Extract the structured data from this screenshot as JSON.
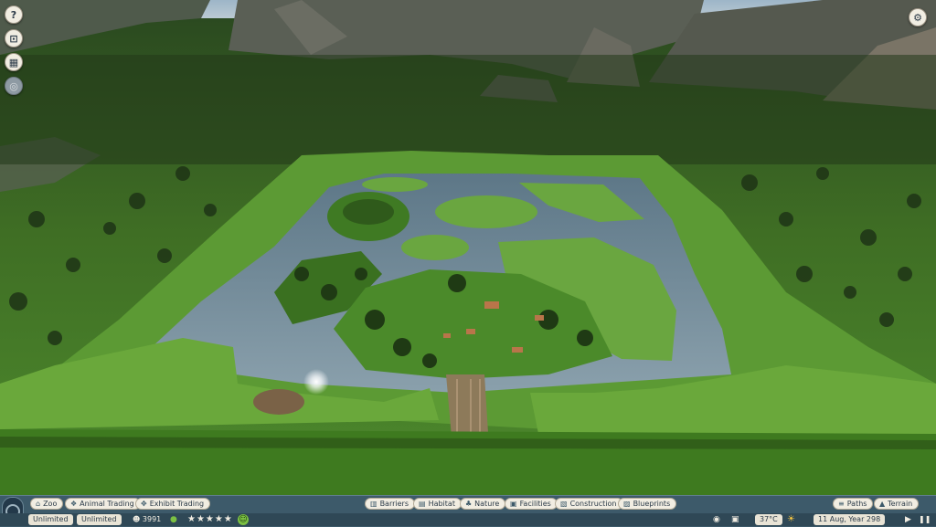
{
  "left_tools": [
    {
      "name": "help-button",
      "glyph": "?"
    },
    {
      "name": "objectives-button",
      "glyph": "⊡"
    },
    {
      "name": "calendar-button",
      "glyph": "▦"
    },
    {
      "name": "heatmap-button",
      "glyph": "◎"
    }
  ],
  "settings_icon": "⚙",
  "top_tabs_left": [
    {
      "label": "Zoo",
      "icon": "⌂"
    },
    {
      "label": "Animal Trading",
      "icon": "❖"
    },
    {
      "label": "Exhibit Trading",
      "icon": "✥"
    }
  ],
  "top_tabs_center": [
    {
      "label": "Barriers",
      "icon": "▥"
    },
    {
      "label": "Habitat",
      "icon": "▤"
    },
    {
      "label": "Nature",
      "icon": "♣"
    },
    {
      "label": "Facilities",
      "icon": "▣"
    },
    {
      "label": "Construction",
      "icon": "▧"
    },
    {
      "label": "Blueprints",
      "icon": "▨"
    }
  ],
  "top_tabs_right": [
    {
      "label": "Paths",
      "icon": "≡"
    },
    {
      "label": "Terrain",
      "icon": "▲"
    }
  ],
  "status": {
    "money": "Unlimited",
    "research": "Unlimited",
    "guests": "3991",
    "rating_stars": "★★★★★",
    "happiness_face": "☺",
    "temperature": "37°C",
    "weather_icon": "☀",
    "date": "11 Aug, Year 298",
    "play_icon": "▶",
    "pause_icon": "❚❚"
  },
  "colors": {
    "toolbar": "#3d5a6a",
    "pill": "#f1ede2",
    "water": "#6a8291",
    "grass": "#4f8a2b"
  }
}
